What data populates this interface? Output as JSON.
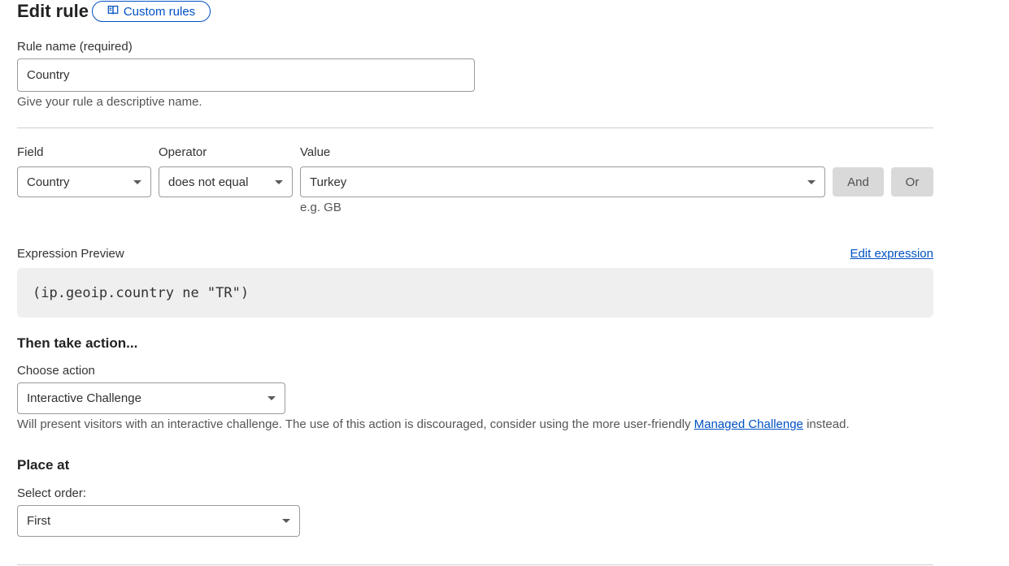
{
  "header": {
    "title": "Edit rule",
    "doc_link_label": "Custom rules",
    "doc_link_icon": "book-icon"
  },
  "rule_name": {
    "label": "Rule name (required)",
    "value": "Country",
    "hint": "Give your rule a descriptive name."
  },
  "expression_builder": {
    "field": {
      "label": "Field",
      "value": "Country"
    },
    "operator": {
      "label": "Operator",
      "value": "does not equal"
    },
    "value": {
      "label": "Value",
      "value": "Turkey",
      "hint": "e.g. GB"
    },
    "and_label": "And",
    "or_label": "Or"
  },
  "expression_preview": {
    "label": "Expression Preview",
    "edit_label": "Edit expression",
    "code": "(ip.geoip.country ne \"TR\")"
  },
  "action": {
    "heading": "Then take action...",
    "label": "Choose action",
    "value": "Interactive Challenge",
    "desc_before": "Will present visitors with an interactive challenge. The use of this action is discouraged, consider using the more user-friendly ",
    "desc_link": "Managed Challenge",
    "desc_after": " instead."
  },
  "placement": {
    "heading": "Place at",
    "label": "Select order:",
    "value": "First"
  },
  "colors": {
    "accent": "#0051c3",
    "preview_bg": "#efefef",
    "button_gray": "#d9d9d9"
  }
}
